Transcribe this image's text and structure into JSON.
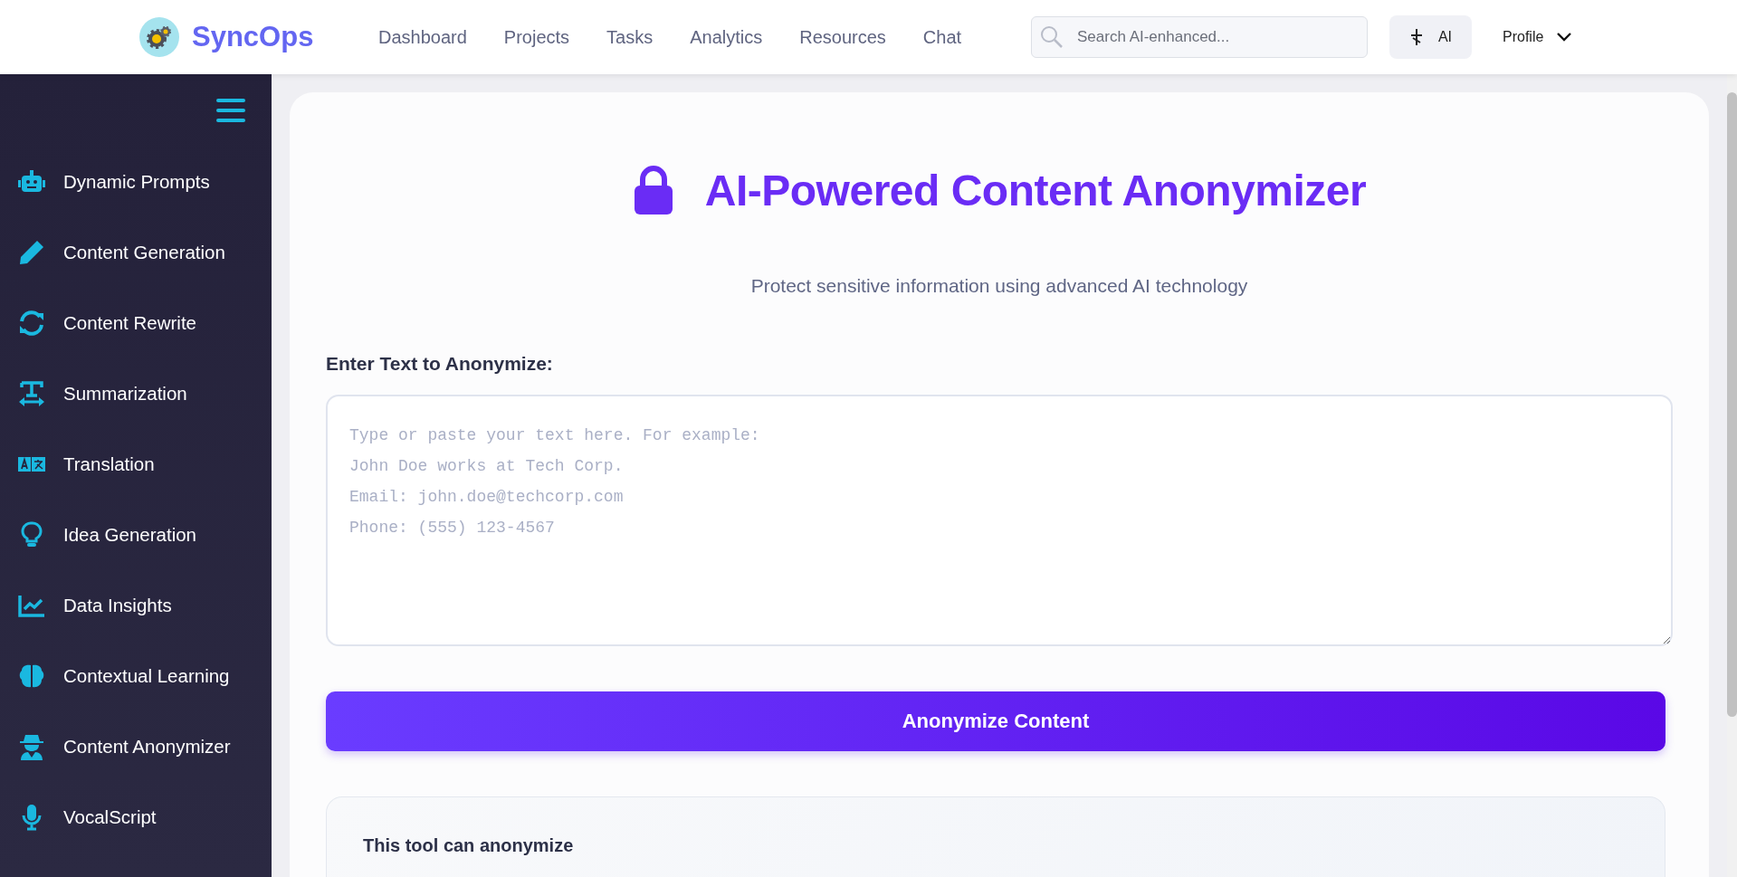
{
  "header": {
    "brand": "SyncOps",
    "nav": [
      "Dashboard",
      "Projects",
      "Tasks",
      "Analytics",
      "Resources",
      "Chat"
    ],
    "search": {
      "placeholder": "Search AI-enhanced..."
    },
    "ai_button": "AI",
    "profile": "Profile"
  },
  "sidebar": {
    "items": [
      {
        "label": "Dynamic Prompts"
      },
      {
        "label": "Content Generation"
      },
      {
        "label": "Content Rewrite"
      },
      {
        "label": "Summarization"
      },
      {
        "label": "Translation"
      },
      {
        "label": "Idea Generation"
      },
      {
        "label": "Data Insights"
      },
      {
        "label": "Contextual Learning"
      },
      {
        "label": "Content Anonymizer"
      },
      {
        "label": "VocalScript"
      }
    ]
  },
  "main": {
    "title": "AI-Powered Content Anonymizer",
    "subtitle": "Protect sensitive information using advanced AI technology",
    "input_label": "Enter Text to Anonymize:",
    "input": {
      "placeholder": "Type or paste your text here. For example:\nJohn Doe works at Tech Corp.\nEmail: john.doe@techcorp.com\nPhone: (555) 123-4567"
    },
    "submit": "Anonymize Content",
    "info_heading": "This tool can anonymize"
  }
}
